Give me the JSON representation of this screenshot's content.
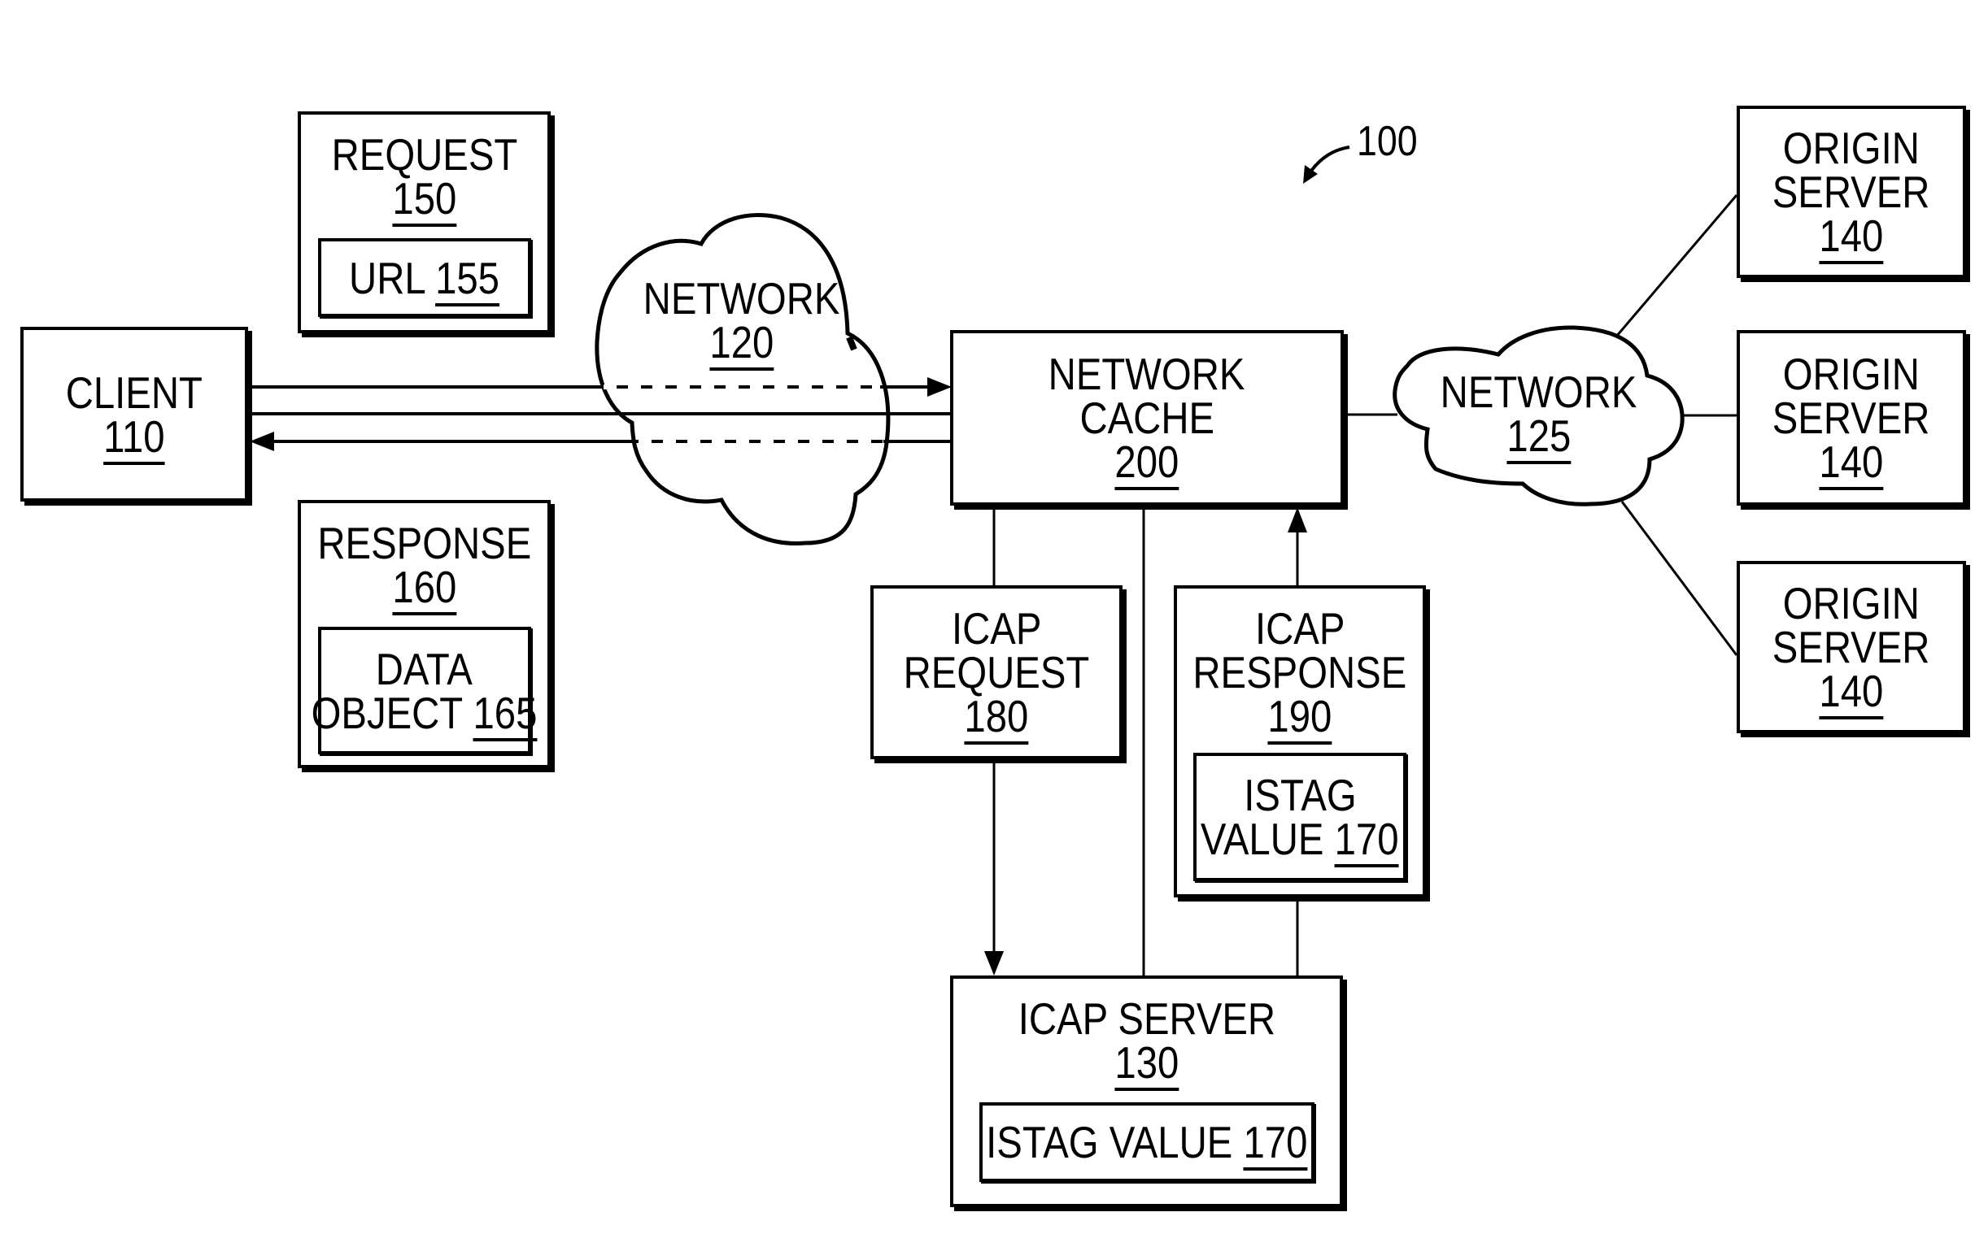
{
  "figure": {
    "reference": "100",
    "nodes": {
      "client": {
        "name": "CLIENT",
        "ref": "110"
      },
      "request": {
        "name": "REQUEST",
        "ref": "150",
        "child": {
          "name": "URL",
          "ref": "155"
        }
      },
      "response": {
        "name": "RESPONSE",
        "ref": "160",
        "child": {
          "name_line1": "DATA",
          "name_line2": "OBJECT",
          "ref": "165"
        }
      },
      "network_120": {
        "name": "NETWORK",
        "ref": "120"
      },
      "network_cache": {
        "name_line1": "NETWORK",
        "name_line2": "CACHE",
        "ref": "200"
      },
      "network_125": {
        "name": "NETWORK",
        "ref": "125"
      },
      "origin_servers": [
        {
          "name_line1": "ORIGIN",
          "name_line2": "SERVER",
          "ref": "140"
        },
        {
          "name_line1": "ORIGIN",
          "name_line2": "SERVER",
          "ref": "140"
        },
        {
          "name_line1": "ORIGIN",
          "name_line2": "SERVER",
          "ref": "140"
        }
      ],
      "icap_request": {
        "name_line1": "ICAP",
        "name_line2": "REQUEST",
        "ref": "180"
      },
      "icap_response": {
        "name_line1": "ICAP",
        "name_line2": "RESPONSE",
        "ref": "190",
        "child": {
          "name_line1": "ISTAG",
          "name_line2": "VALUE",
          "ref": "170"
        }
      },
      "icap_server": {
        "name": "ICAP SERVER",
        "ref": "130",
        "child": {
          "name": "ISTAG VALUE",
          "ref": "170"
        }
      }
    },
    "connections": [
      {
        "from": "client",
        "to": "network_cache",
        "style": "arrow",
        "via": "network_120"
      },
      {
        "from": "client",
        "to": "network_cache",
        "style": "plain",
        "via": "network_120"
      },
      {
        "from": "network_cache",
        "to": "client",
        "style": "arrow",
        "via": "network_120"
      },
      {
        "from": "network_cache",
        "to": "network_125",
        "style": "plain"
      },
      {
        "from": "network_125",
        "to": "origin_servers.0",
        "style": "plain"
      },
      {
        "from": "network_125",
        "to": "origin_servers.1",
        "style": "plain"
      },
      {
        "from": "network_125",
        "to": "origin_servers.2",
        "style": "plain"
      },
      {
        "from": "network_cache",
        "to": "icap_server",
        "style": "arrow",
        "label_node": "icap_request"
      },
      {
        "from": "network_cache",
        "to": "icap_server",
        "style": "plain"
      },
      {
        "from": "icap_server",
        "to": "network_cache",
        "style": "arrow",
        "label_node": "icap_response"
      }
    ]
  }
}
